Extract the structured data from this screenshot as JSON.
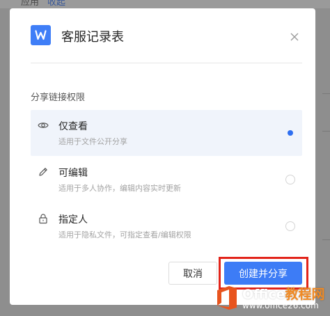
{
  "background": {
    "tab_a": "应用",
    "tab_b": "收起"
  },
  "dialog": {
    "app_icon_letter": "W",
    "title": "客服记录表",
    "section_label": "分享链接权限",
    "options": [
      {
        "icon": "eye-icon",
        "title": "仅查看",
        "description": "适用于文件公开分享",
        "selected": true
      },
      {
        "icon": "pencil-icon",
        "title": "可编辑",
        "description": "适用于多人协作，编辑内容实时更新",
        "selected": false
      },
      {
        "icon": "lock-icon",
        "title": "指定人",
        "description": "适用于隐私文件，可指定查看/编辑权限",
        "selected": false
      }
    ],
    "cancel_label": "取消",
    "create_label": "创建并分享"
  },
  "watermark": {
    "brand_latin": "Office",
    "brand_cn": "教程网",
    "url": "www.office26.com"
  },
  "colors": {
    "accent": "#3d7cf6",
    "app_icon": "#3f7ef7",
    "highlight": "#e2241a",
    "selected_row": "#f0f4fb",
    "watermark_orange": "#f08a24"
  }
}
